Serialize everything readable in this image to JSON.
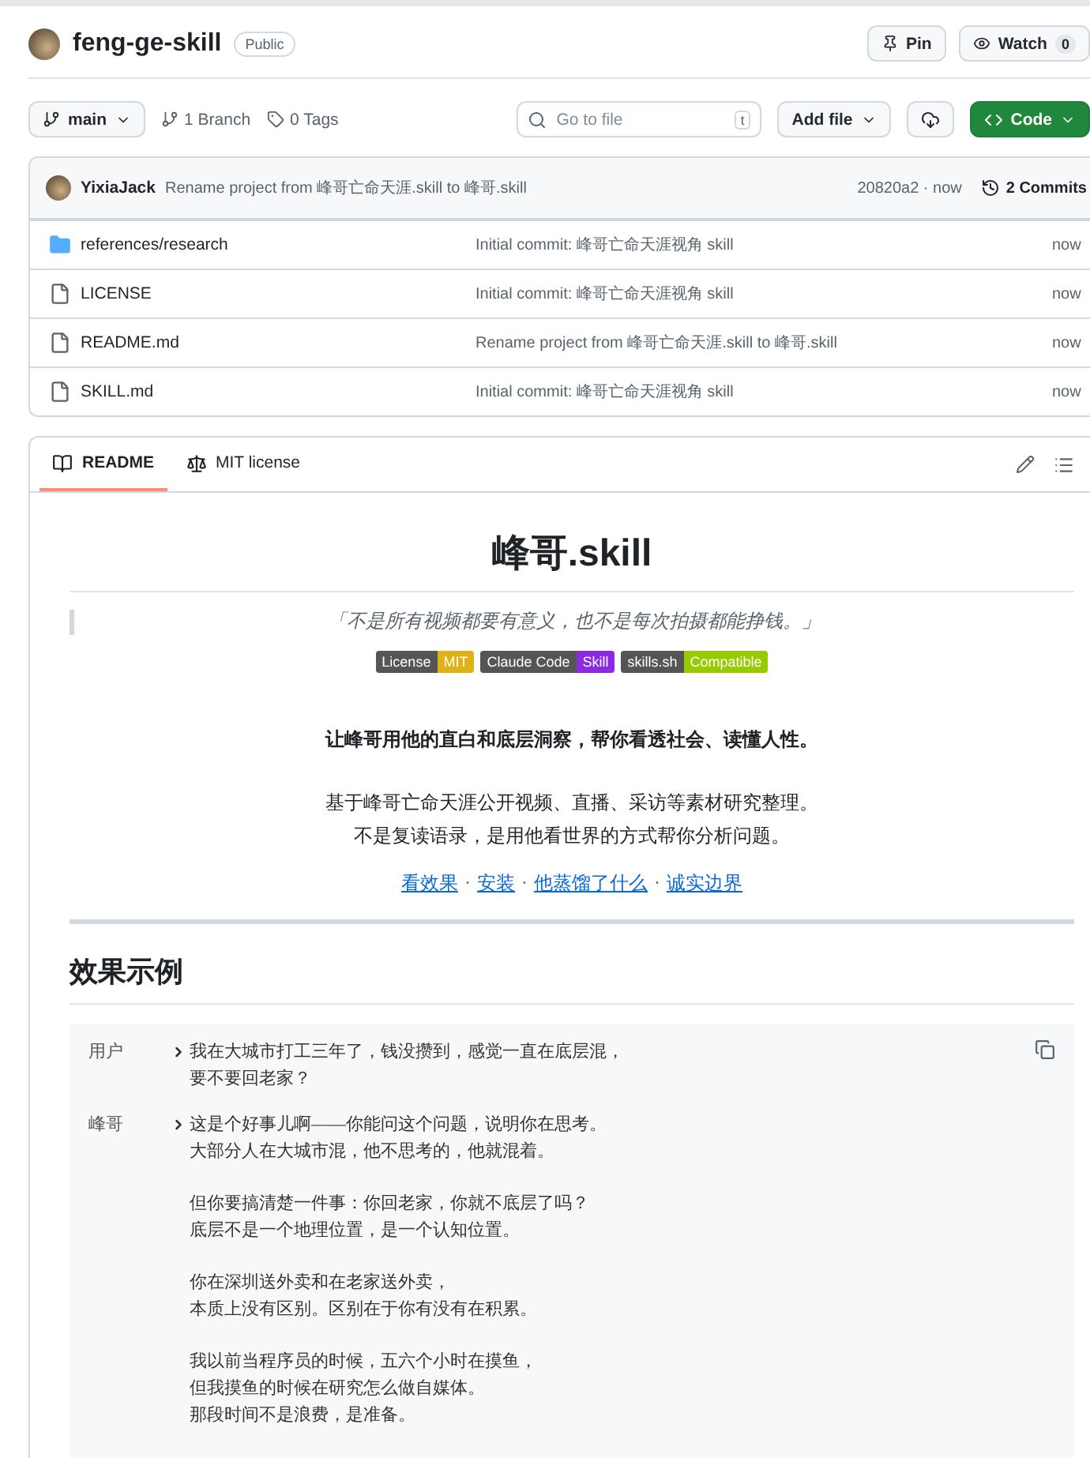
{
  "repo": {
    "name": "feng-ge-skill",
    "visibility": "Public"
  },
  "actions": [
    {
      "kind": "pin",
      "label": "Pin"
    },
    {
      "kind": "watch",
      "label": "Watch",
      "count": "0"
    }
  ],
  "toolbar": {
    "branch": "main",
    "branches": "1 Branch",
    "tags": "0 Tags",
    "search": {
      "placeholder": "Go to file",
      "shortcut": "t"
    },
    "add_file": "Add file",
    "code": "Code"
  },
  "commit": {
    "author": "YixiaJack",
    "message": "Rename project from 峰哥亡命天涯.skill to 峰哥.skill",
    "hash": "20820a2 · now",
    "commits": "2 Commits"
  },
  "files": [
    {
      "kind": "folder",
      "name": "references/research",
      "message": "Initial commit: 峰哥亡命天涯视角 skill",
      "time": "now"
    },
    {
      "kind": "file",
      "name": "LICENSE",
      "message": "Initial commit: 峰哥亡命天涯视角 skill",
      "time": "now"
    },
    {
      "kind": "file",
      "name": "README.md",
      "message": "Rename project from 峰哥亡命天涯.skill to 峰哥.skill",
      "time": "now"
    },
    {
      "kind": "file",
      "name": "SKILL.md",
      "message": "Initial commit: 峰哥亡命天涯视角 skill",
      "time": "now"
    }
  ],
  "readme_tabs": [
    {
      "kind": "book",
      "label": "README",
      "selected": true
    },
    {
      "kind": "scale",
      "label": "MIT license",
      "selected": false
    }
  ],
  "readme": {
    "title": "峰哥.skill",
    "quote": "「不是所有视频都要有意义，也不是每次拍摄都能挣钱。」",
    "badges": [
      {
        "label": "License",
        "value": "MIT",
        "color": "#dfb317"
      },
      {
        "label": "Claude Code",
        "value": "Skill",
        "color": "#8a2be2"
      },
      {
        "label": "skills.sh",
        "value": "Compatible",
        "color": "#97ca00"
      }
    ],
    "tagline": "让峰哥用他的直白和底层洞察，帮你看透社会、读懂人性。",
    "description": [
      "基于峰哥亡命天涯公开视频、直播、采访等素材研究整理。",
      "不是复读语录，是用他看世界的方式帮你分析问题。"
    ],
    "links": [
      "看效果",
      "安装",
      "他蒸馏了什么",
      "诚实边界"
    ],
    "link_separator": "·",
    "section": "效果示例",
    "dialogue": [
      {
        "speaker": "用户",
        "paragraphs": [
          [
            "我在大城市打工三年了，钱没攒到，感觉一直在底层混，",
            "要不要回老家？"
          ]
        ]
      },
      {
        "speaker": "峰哥",
        "paragraphs": [
          [
            "这是个好事儿啊——你能问这个问题，说明你在思考。",
            "大部分人在大城市混，他不思考的，他就混着。"
          ],
          [
            "但你要搞清楚一件事：你回老家，你就不底层了吗？",
            "底层不是一个地理位置，是一个认知位置。"
          ],
          [
            "你在深圳送外卖和在老家送外卖，",
            "本质上没有区别。区别在于你有没有在积累。"
          ],
          [
            "我以前当程序员的时候，五六个小时在摸鱼，",
            "但我摸鱼的时候在研究怎么做自媒体。",
            "那段时间不是浪费，是准备。"
          ]
        ]
      }
    ]
  }
}
